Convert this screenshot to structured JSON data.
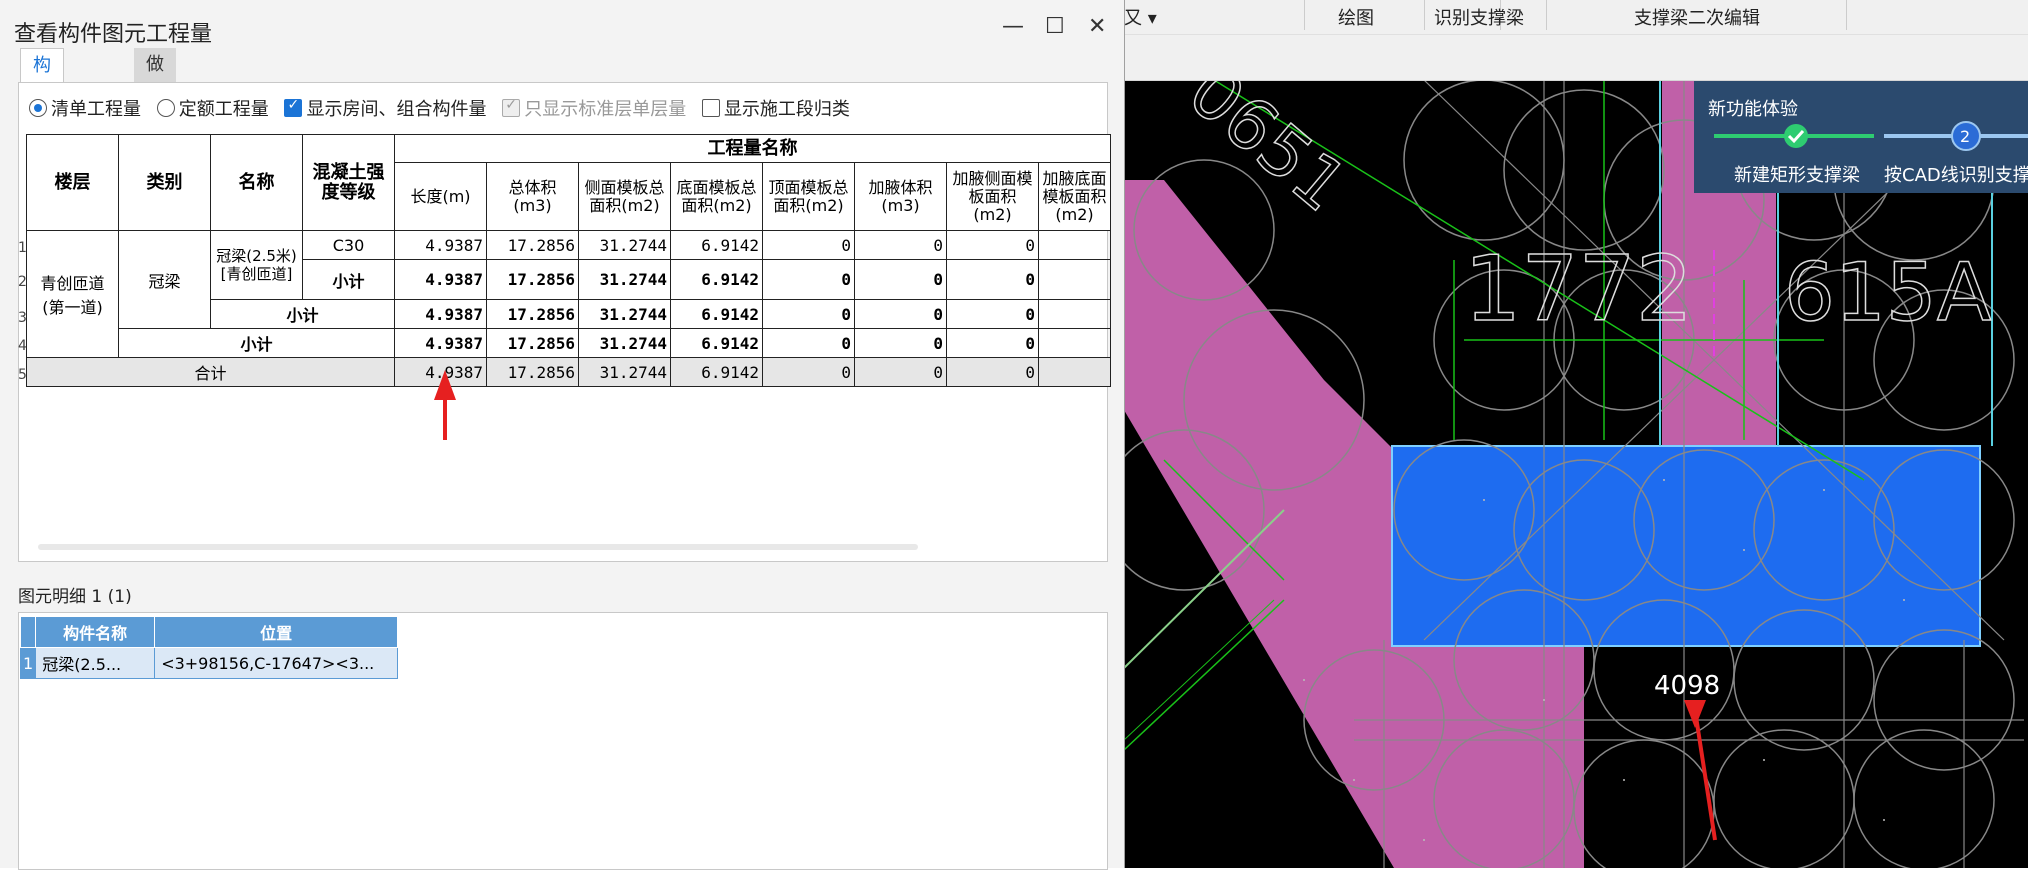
{
  "topbar": {
    "partial_left": "又 ▾",
    "btn_draw": "绘图",
    "btn_identify": "识别支撑梁",
    "btn_edit": "支撑梁二次编辑"
  },
  "guide": {
    "title": "新功能体验",
    "step1": "新建矩形支撑梁",
    "step2_num": "2",
    "step2": "按CAD线识别支撑"
  },
  "cad": {
    "dimension": "4098",
    "text_a": "1772",
    "text_b": "615A",
    "text_c": "0651"
  },
  "dialog": {
    "title": "查看构件图元工程量",
    "tabs": [
      "构件工程量",
      "做法工程量"
    ],
    "options": {
      "radio1": "清单工程量",
      "radio2": "定额工程量",
      "cb1": "显示房间、组合构件量",
      "cb2": "只显示标准层单层量",
      "cb3": "显示施工段归类"
    },
    "table": {
      "group_header": "工程量名称",
      "headers": {
        "floor": "楼层",
        "category": "类别",
        "name": "名称",
        "grade": "混凝土强度等级"
      },
      "metric_headers": [
        "长度(m)",
        "总体积(m3)",
        "侧面模板总面积(m2)",
        "底面模板总面积(m2)",
        "顶面模板总面积(m2)",
        "加腋体积(m3)",
        "加腋侧面模板面积(m2)",
        "加腋底面模板面积(m2)"
      ],
      "floor_value": "青创匝道(第一道)",
      "category_value": "冠梁",
      "name_value": "冠梁(2.5米)[青创匝道]",
      "grade_value": "C30",
      "subtotal": "小计",
      "total": "合计",
      "row_values": [
        "4.9387",
        "17.2856",
        "31.2744",
        "6.9142",
        "0",
        "0",
        "0",
        ""
      ]
    },
    "detail": {
      "label": "图元明细 1 (1)",
      "headers": [
        "构件名称",
        "位置"
      ],
      "row_num": "1",
      "rows": [
        [
          "冠梁(2.5...",
          "<3+98156,C-17647><3..."
        ]
      ]
    },
    "row_numbers": [
      "1",
      "2",
      "3",
      "4",
      "5"
    ]
  },
  "colors": {
    "accent": "#1b74d6",
    "cad_bg": "#000000",
    "magenta": "#c060a8",
    "blue_beam": "#1e6cf0",
    "guide_bg": "#2b4a6e",
    "detail_header": "#5b9bd5"
  }
}
